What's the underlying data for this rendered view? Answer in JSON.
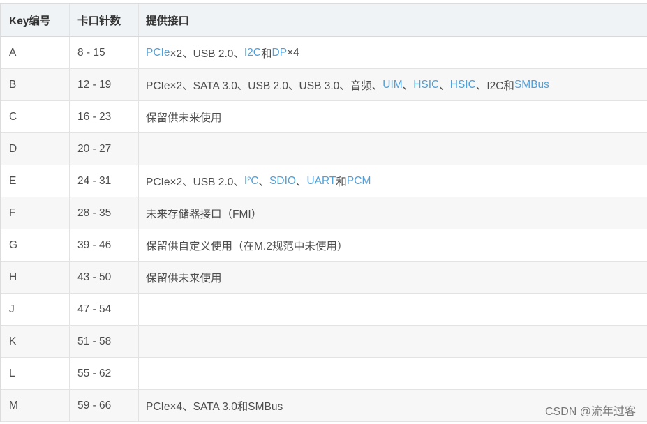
{
  "headers": [
    "Key编号",
    "卡口针数",
    "提供接口"
  ],
  "rows": [
    {
      "key": "A",
      "pins": "8 - 15",
      "parts": [
        {
          "t": "PCIe",
          "link": true
        },
        {
          "t": "×2、USB 2.0、"
        },
        {
          "t": "I2C",
          "link": true
        },
        {
          "t": "和"
        },
        {
          "t": "DP",
          "link": true
        },
        {
          "t": "×4"
        }
      ]
    },
    {
      "key": "B",
      "pins": "12 - 19",
      "parts": [
        {
          "t": "PCIe×2、SATA 3.0、USB 2.0、USB 3.0、音频、"
        },
        {
          "t": "UIM",
          "link": true
        },
        {
          "t": "、"
        },
        {
          "t": "HSIC",
          "link": true
        },
        {
          "t": "、"
        },
        {
          "t": "HSIC",
          "link": true
        },
        {
          "t": "、I2C和"
        },
        {
          "t": "SMBus",
          "link": true
        }
      ]
    },
    {
      "key": "C",
      "pins": "16 - 23",
      "parts": [
        {
          "t": "保留供未来使用"
        }
      ]
    },
    {
      "key": "D",
      "pins": "20 - 27",
      "parts": []
    },
    {
      "key": "E",
      "pins": "24 - 31",
      "parts": [
        {
          "t": "PCIe×2、USB 2.0、"
        },
        {
          "t": "I²C",
          "link": true
        },
        {
          "t": "、"
        },
        {
          "t": "SDIO",
          "link": true
        },
        {
          "t": "、"
        },
        {
          "t": "UART",
          "link": true
        },
        {
          "t": "和"
        },
        {
          "t": "PCM",
          "link": true
        }
      ]
    },
    {
      "key": "F",
      "pins": "28 - 35",
      "parts": [
        {
          "t": "未来存储器接口（FMI）"
        }
      ]
    },
    {
      "key": "G",
      "pins": "39 - 46",
      "parts": [
        {
          "t": "保留供自定义使用（在M.2规范中未使用）"
        }
      ]
    },
    {
      "key": "H",
      "pins": "43 - 50",
      "parts": [
        {
          "t": "保留供未来使用"
        }
      ]
    },
    {
      "key": "J",
      "pins": "47 - 54",
      "parts": []
    },
    {
      "key": "K",
      "pins": "51 - 58",
      "parts": []
    },
    {
      "key": "L",
      "pins": "55 - 62",
      "parts": []
    },
    {
      "key": "M",
      "pins": "59 - 66",
      "parts": [
        {
          "t": "PCIe×4、SATA 3.0和SMBus"
        }
      ]
    }
  ],
  "watermark": "CSDN @流年过客",
  "colors": {
    "link": "#4ea1db",
    "header_bg": "#eff3f5",
    "stripe_bg": "#f7f7f7",
    "text": "#4d4d4d"
  }
}
